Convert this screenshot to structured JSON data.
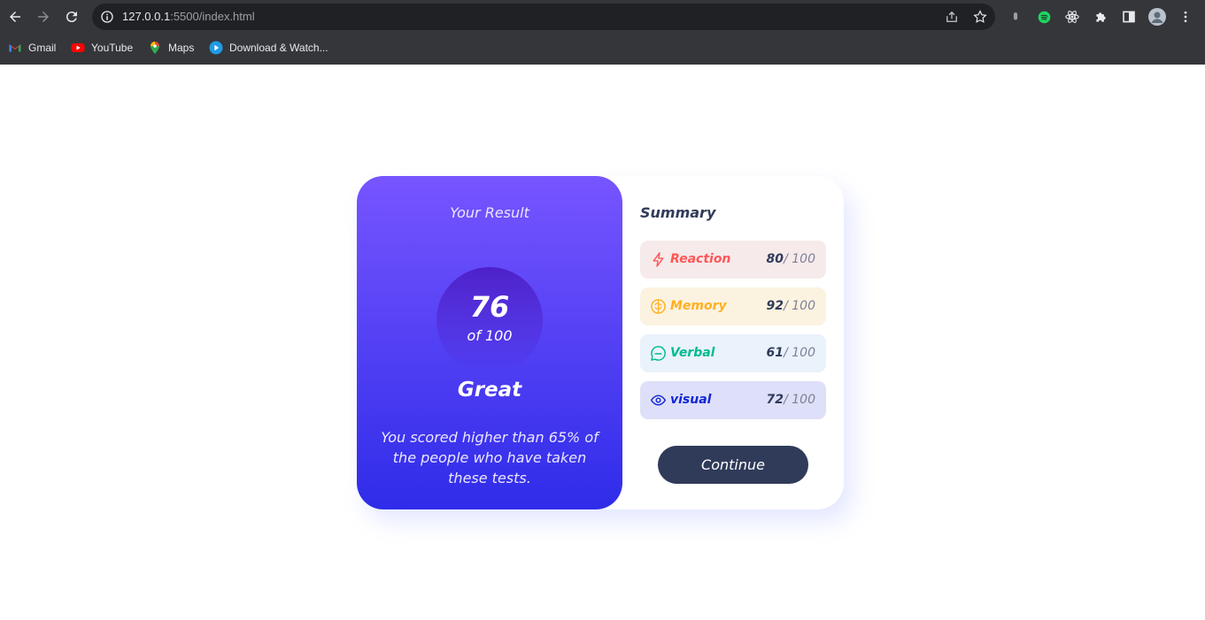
{
  "browser": {
    "url_host": "127.0.0.1",
    "url_path": ":5500/index.html",
    "bookmarks": [
      {
        "label": "Gmail"
      },
      {
        "label": "YouTube"
      },
      {
        "label": "Maps"
      },
      {
        "label": "Download & Watch..."
      }
    ]
  },
  "result": {
    "title": "Your Result",
    "score": "76",
    "out_of": "of 100",
    "grade": "Great",
    "description": "You scored higher than 65% of the people who have taken these tests."
  },
  "summary": {
    "title": "Summary",
    "items": [
      {
        "label": "Reaction",
        "score": "80",
        "max": "/ 100",
        "color": "#ff5757",
        "bg": "#f6eaea",
        "icon": "lightning-icon"
      },
      {
        "label": "Memory",
        "score": "92",
        "max": "/ 100",
        "color": "#ffb01f",
        "bg": "#fbf2e0",
        "icon": "brain-icon"
      },
      {
        "label": "Verbal",
        "score": "61",
        "max": "/ 100",
        "color": "#00bb8f",
        "bg": "#eaf2fb",
        "icon": "chat-icon"
      },
      {
        "label": "visual",
        "score": "72",
        "max": "/ 100",
        "color": "#1125d6",
        "bg": "#dedff8",
        "icon": "eye-icon"
      }
    ],
    "continue_label": "Continue"
  }
}
